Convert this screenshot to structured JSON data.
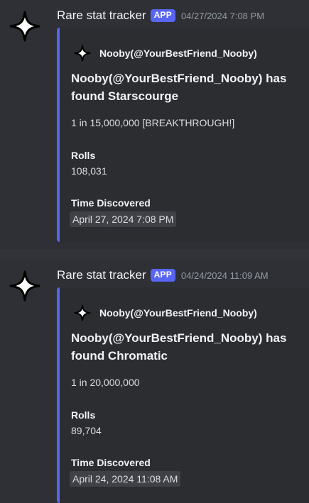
{
  "messages": [
    {
      "username": "Rare stat tracker",
      "badge": "APP",
      "timestamp": "04/27/2024 7:08 PM",
      "embed": {
        "author": "Nooby(@YourBestFriend_Nooby)",
        "title": "Nooby(@YourBestFriend_Nooby) has found Starscourge",
        "description": "1 in 15,000,000 [BREAKTHROUGH!]",
        "fields": [
          {
            "name": "Rolls",
            "value": "108,031"
          },
          {
            "name": "Time Discovered",
            "value": "April 27, 2024 7:08 PM"
          }
        ]
      }
    },
    {
      "username": "Rare stat tracker",
      "badge": "APP",
      "timestamp": "04/24/2024 11:09 AM",
      "embed": {
        "author": "Nooby(@YourBestFriend_Nooby)",
        "title": "Nooby(@YourBestFriend_Nooby) has found Chromatic",
        "description": "1 in 20,000,000",
        "fields": [
          {
            "name": "Rolls",
            "value": "89,704"
          },
          {
            "name": "Time Discovered",
            "value": "April 24, 2024 11:08 AM"
          }
        ]
      }
    }
  ],
  "icons": {
    "avatar": "sparkle-icon",
    "author": "sparkle-icon"
  },
  "colors": {
    "background": "#313338",
    "embed_background": "#2b2d31",
    "embed_accent": "#5865f2",
    "badge": "#5865f2",
    "timestamp_text": "#949ba4",
    "heading_text": "#f2f3f5",
    "body_text": "#dbdee1",
    "time_highlight": "#3f4147"
  }
}
